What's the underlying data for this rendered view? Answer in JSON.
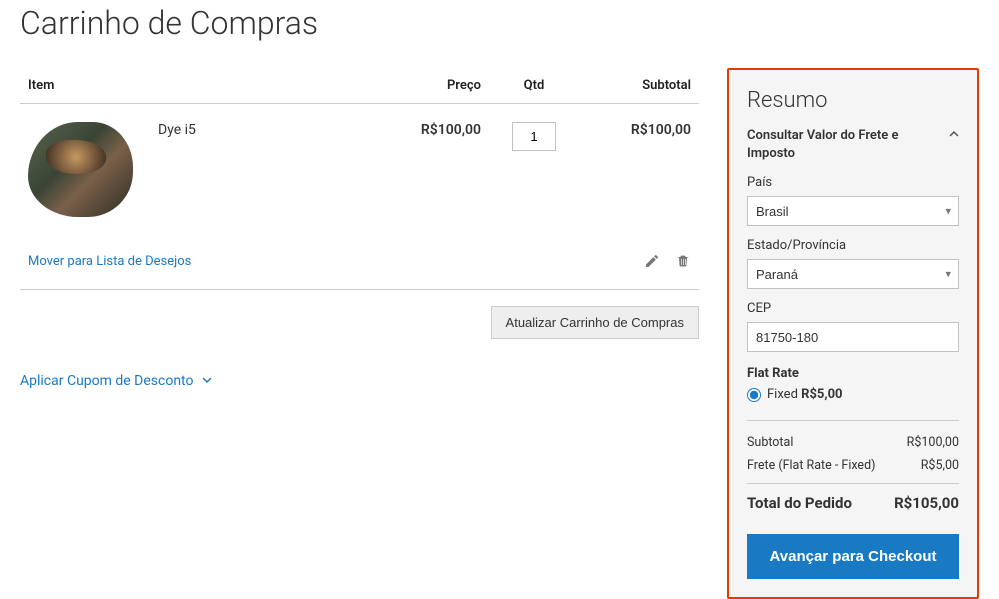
{
  "page": {
    "title": "Carrinho de Compras"
  },
  "cart": {
    "columns": {
      "item": "Item",
      "price": "Preço",
      "qty": "Qtd",
      "subtotal": "Subtotal"
    },
    "items": [
      {
        "name": "Dye i5",
        "price": "R$100,00",
        "qty": "1",
        "subtotal": "R$100,00"
      }
    ],
    "move_to_wishlist": "Mover para Lista de Desejos",
    "update_cart": "Atualizar Carrinho de Compras",
    "apply_coupon": "Aplicar Cupom de Desconto"
  },
  "summary": {
    "title": "Resumo",
    "estimate_block_title": "Consultar Valor do Frete e Imposto",
    "country": {
      "label": "País",
      "value": "Brasil"
    },
    "region": {
      "label": "Estado/Província",
      "value": "Paraná"
    },
    "postcode": {
      "label": "CEP",
      "value": "81750-180"
    },
    "shipping": {
      "carrier": "Flat Rate",
      "method_label": "Fixed",
      "method_price": "R$5,00"
    },
    "totals": {
      "subtotal_label": "Subtotal",
      "subtotal_value": "R$100,00",
      "shipping_label": "Frete (Flat Rate - Fixed)",
      "shipping_value": "R$5,00",
      "grand_label": "Total do Pedido",
      "grand_value": "R$105,00"
    },
    "checkout_button": "Avançar para Checkout"
  }
}
